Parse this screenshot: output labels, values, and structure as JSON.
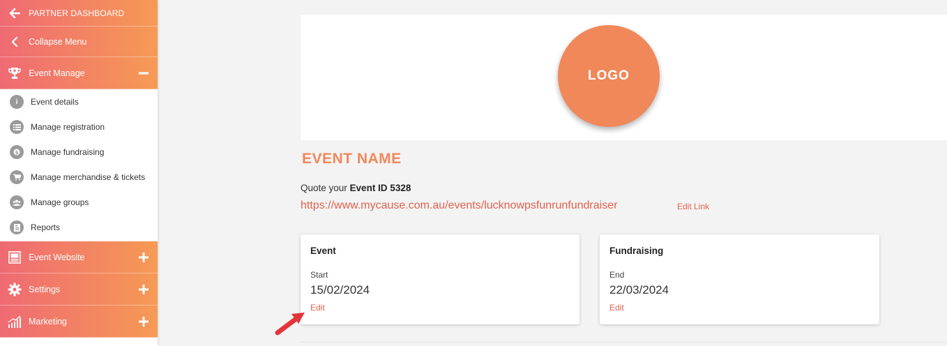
{
  "sidebar": {
    "partner": "PARTNER DASHBOARD",
    "collapse": "Collapse Menu",
    "event_manage": "Event Manage",
    "sub_items": [
      {
        "label": "Event details",
        "icon": "info-icon"
      },
      {
        "label": "Manage registration",
        "icon": "list-icon"
      },
      {
        "label": "Manage fundraising",
        "icon": "dollar-icon"
      },
      {
        "label": "Manage merchandise & tickets",
        "icon": "cart-icon"
      },
      {
        "label": "Manage groups",
        "icon": "group-icon"
      },
      {
        "label": "Reports",
        "icon": "report-icon"
      }
    ],
    "event_website": "Event Website",
    "settings": "Settings",
    "marketing": "Marketing"
  },
  "main": {
    "logo": "LOGO",
    "event_name": "EVENT NAME",
    "quote_prefix": "Quote your ",
    "event_id": "Event ID 5328",
    "url": "https://www.mycause.com.au/events/lucknowpsfunrunfundraiser",
    "edit_link": "Edit Link",
    "cards": [
      {
        "title": "Event",
        "key": "Start",
        "value": "15/02/2024",
        "edit": "Edit"
      },
      {
        "title": "Fundraising",
        "key": "End",
        "value": "22/03/2024",
        "edit": "Edit"
      }
    ]
  },
  "colors": {
    "accent": "#f0885a",
    "link": "#e2614f",
    "gradient_start": "#ef6a73",
    "gradient_end": "#f69a55"
  }
}
